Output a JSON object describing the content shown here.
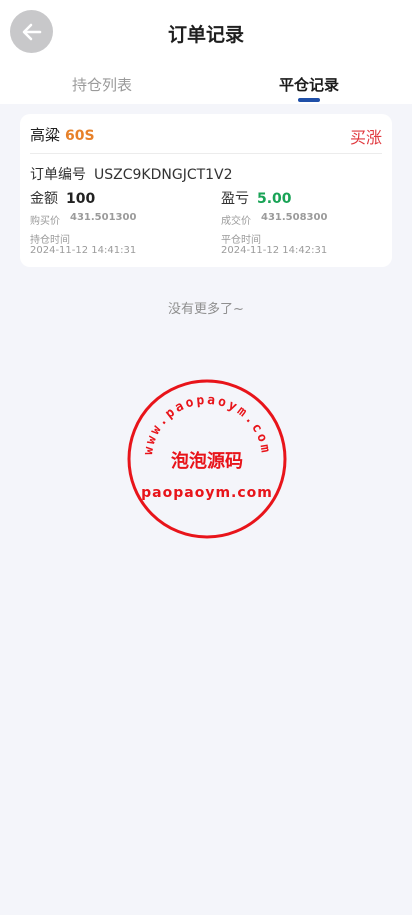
{
  "header": {
    "title": "订单记录",
    "back_icon": "arrow-left-icon"
  },
  "tabs": [
    {
      "label": "持仓列表",
      "active": false
    },
    {
      "label": "平仓记录",
      "active": true
    }
  ],
  "accent_color": "#1f4fa8",
  "order": {
    "name": "高粱",
    "period": "60S",
    "direction": "买涨",
    "order_no_label": "订单编号",
    "order_no": "USZC9KDNGJCT1V2",
    "amount_label": "金额",
    "amount": "100",
    "pnl_label": "盈亏",
    "pnl": "5.00",
    "buy_price_label": "购买价",
    "buy_price": "431.501300",
    "deal_price_label": "成交价",
    "deal_price": "431.508300",
    "open_time_label": "持仓时间",
    "open_time": "2024-11-12 14:41:31",
    "close_time_label": "平仓时间",
    "close_time": "2024-11-12 14:42:31"
  },
  "list_end_text": "没有更多了~",
  "watermark": {
    "top_arc": "www.paopaoym.com",
    "center": "泡泡源码",
    "bottom": "paopaoym.com",
    "color": "#e8141a"
  }
}
